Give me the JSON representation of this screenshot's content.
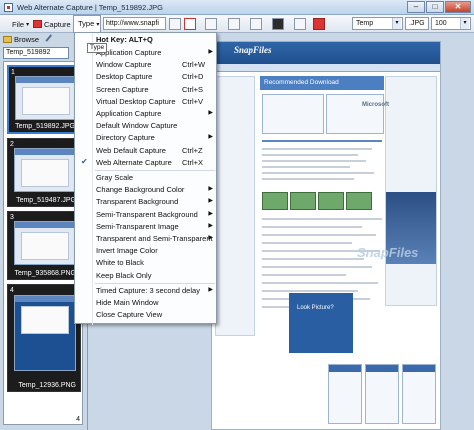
{
  "window": {
    "title": "Web Alternate Capture | Temp_519892.JPG",
    "minimize": "–",
    "maximize": "□",
    "close": "✕"
  },
  "toolbar": {
    "file_label": "File",
    "capture_label": "Capture",
    "type_label": "Type",
    "url_value": "http://www.snapfi",
    "folder_value": "Temp",
    "format_value": ".JPG",
    "quality_value": "100",
    "dropdown_caret": "▾"
  },
  "left_panel": {
    "browse_label": "Browse",
    "filename_value": "Temp_519892",
    "thumbnails": [
      {
        "number": "1",
        "label": "Temp_519892.JPG"
      },
      {
        "number": "2",
        "label": "Temp_519487.JPG"
      },
      {
        "number": "3",
        "label": "Temp_935868.PNG"
      },
      {
        "number": "4",
        "label": "Temp_12936.PNG"
      }
    ],
    "count": "4"
  },
  "preview": {
    "logo": "SnapFiles",
    "banner_title": "Recommended Download",
    "ms_logo": "Microsoft",
    "ad_text": "Look Picture?",
    "watermark": "SnapFiles"
  },
  "type_menu": {
    "tooltip": "Type",
    "hotkey": "Hot Key: ALT+Q",
    "items": [
      {
        "label": "Application Capture",
        "key": "",
        "submenu": true,
        "checked": false
      },
      {
        "label": "Window Capture",
        "key": "Ctrl+W",
        "submenu": false,
        "checked": false
      },
      {
        "label": "Desktop Capture",
        "key": "Ctrl+D",
        "submenu": false,
        "checked": false
      },
      {
        "label": "Screen Capture",
        "key": "Ctrl+S",
        "submenu": false,
        "checked": false
      },
      {
        "label": "Virtual Desktop Capture",
        "key": "Ctrl+V",
        "submenu": false,
        "checked": false
      },
      {
        "label": "Application Capture",
        "key": "",
        "submenu": true,
        "checked": false
      },
      {
        "label": "Default Window Capture",
        "key": "",
        "submenu": false,
        "checked": false
      },
      {
        "label": "Directory Capture",
        "key": "",
        "submenu": true,
        "checked": false
      },
      {
        "label": "Web Default Capture",
        "key": "Ctrl+Z",
        "submenu": false,
        "checked": false
      },
      {
        "label": "Web Alternate Capture",
        "key": "Ctrl+X",
        "submenu": false,
        "checked": true
      },
      {
        "label": "Gray Scale",
        "key": "",
        "submenu": false,
        "checked": false
      },
      {
        "label": "Change Background Color",
        "key": "",
        "submenu": true,
        "checked": false
      },
      {
        "label": "Transparent Background",
        "key": "",
        "submenu": true,
        "checked": false
      },
      {
        "label": "Semi-Transparent Background",
        "key": "",
        "submenu": true,
        "checked": false
      },
      {
        "label": "Semi-Transparent Image",
        "key": "",
        "submenu": true,
        "checked": false
      },
      {
        "label": "Transparent and Semi-Transparent",
        "key": "",
        "submenu": true,
        "checked": false
      },
      {
        "label": "Invert Image Color",
        "key": "",
        "submenu": false,
        "checked": false
      },
      {
        "label": "White to Black",
        "key": "",
        "submenu": false,
        "checked": false
      },
      {
        "label": "Keep Black Only",
        "key": "",
        "submenu": false,
        "checked": false
      },
      {
        "label": "Timed Capture: 3 second delay",
        "key": "",
        "submenu": true,
        "checked": false
      },
      {
        "label": "Hide Main Window",
        "key": "",
        "submenu": false,
        "checked": false
      },
      {
        "label": "Close Capture View",
        "key": "",
        "submenu": false,
        "checked": false
      }
    ],
    "submenu_arrow": "▶",
    "checkmark": "✔"
  }
}
